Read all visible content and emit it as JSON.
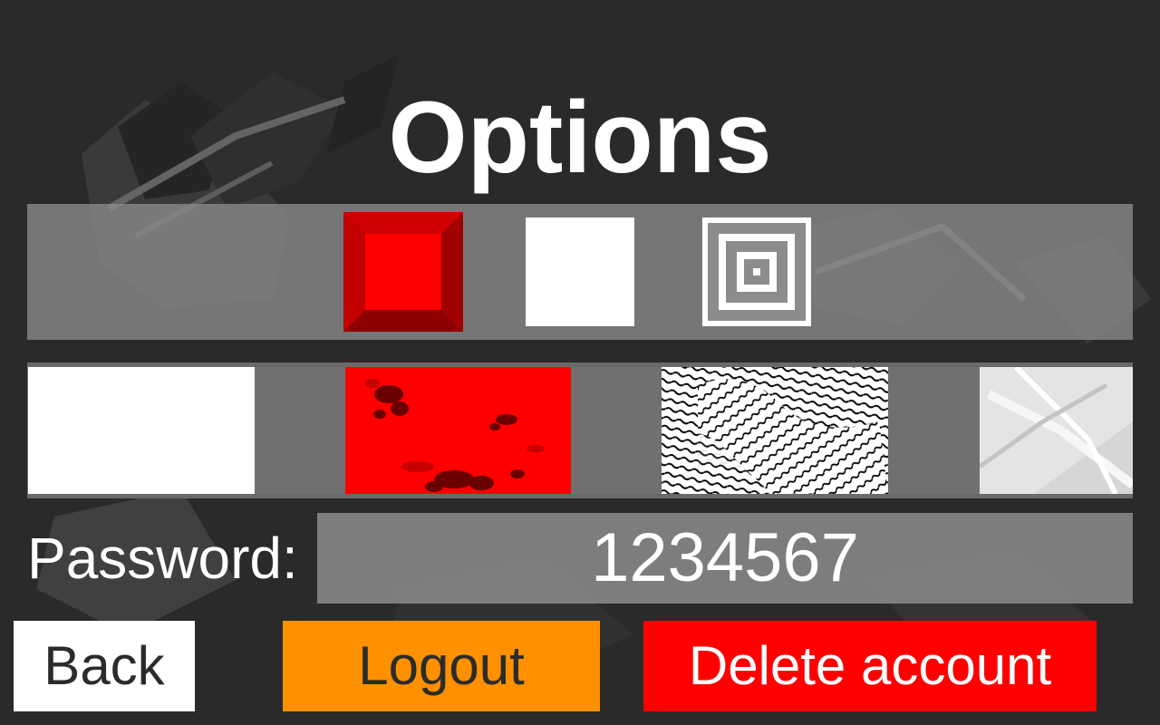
{
  "screen": {
    "title": "Options"
  },
  "tiles": [
    {
      "name": "red-bevel-tile",
      "color": "#ff0000"
    },
    {
      "name": "white-tile",
      "color": "#ffffff"
    },
    {
      "name": "concentric-square-tile",
      "color": "#8c8c8c"
    }
  ],
  "backgrounds": [
    {
      "name": "white-background",
      "color": "#ffffff"
    },
    {
      "name": "red-splatter-background",
      "color": "#ff0000"
    },
    {
      "name": "black-white-pattern-background",
      "color": "#000000"
    },
    {
      "name": "gray-abstract-background",
      "color": "#dddddd"
    }
  ],
  "password": {
    "label": "Password:",
    "value": "1234567"
  },
  "buttons": {
    "back": "Back",
    "logout": "Logout",
    "delete": "Delete account"
  },
  "colors": {
    "page_bg": "#2a2a2a",
    "panel": "#8c8c8c",
    "logout": "#ff9000",
    "delete": "#ff0000",
    "back": "#ffffff"
  }
}
